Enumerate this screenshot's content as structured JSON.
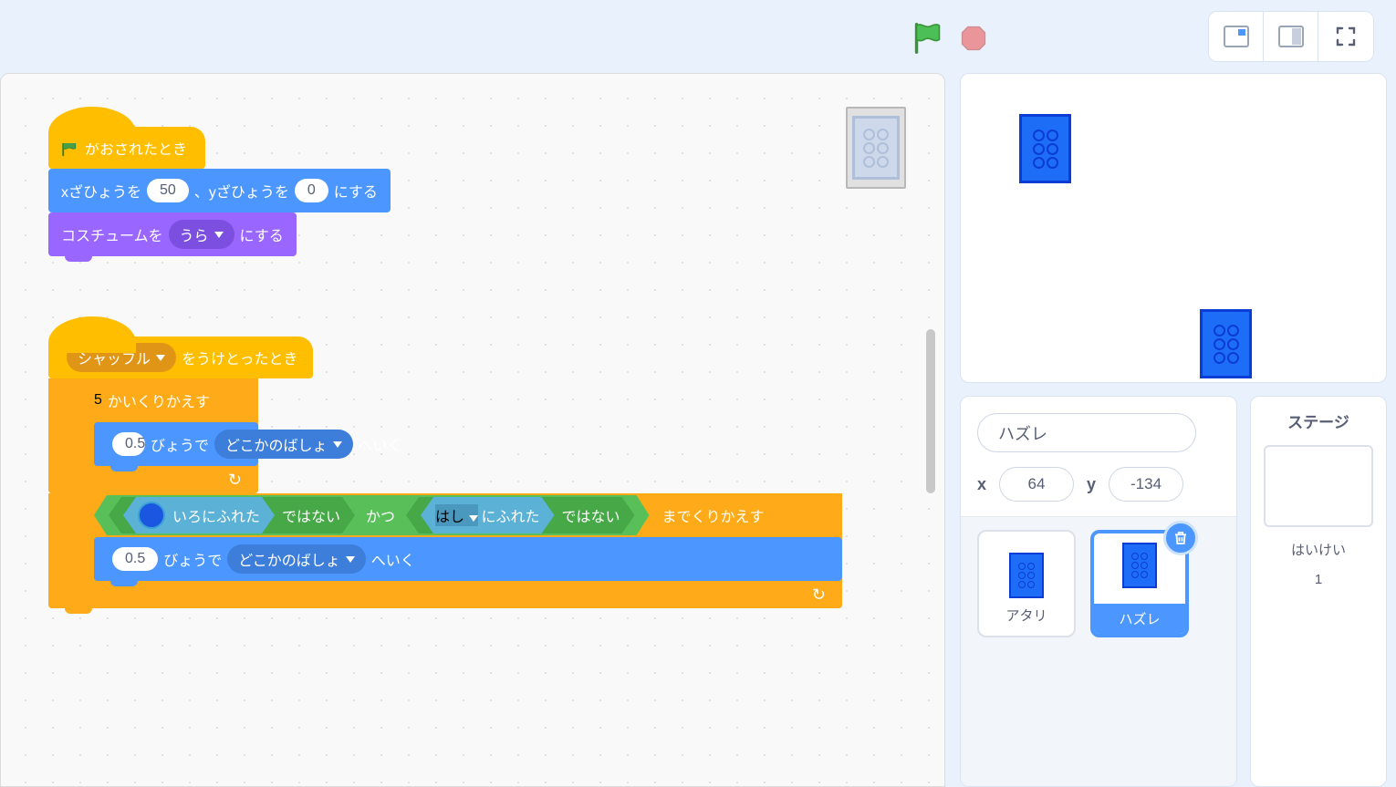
{
  "controls": {
    "flag_alt": "green-flag",
    "stop_alt": "stop"
  },
  "blocks": {
    "hat_flag": "がおされたとき",
    "goto_prefix_x": "xざひょうを",
    "goto_mid_y": "、yざひょうを",
    "goto_suffix": "にする",
    "goto_x_val": "50",
    "goto_y_val": "0",
    "switch_costume_pre": "コスチュームを",
    "switch_costume_opt": "うら",
    "switch_costume_suf": "にする",
    "hat_receive_opt": "シャッフル",
    "hat_receive_suf": "をうけとったとき",
    "repeat_val": "5",
    "repeat_suf": "かいくりかえす",
    "glide_val": "0.5",
    "glide_mid": "びょうで",
    "glide_opt": "どこかのばしょ",
    "glide_suf": "へいく",
    "repeat_until_suf": "までくりかえす",
    "not_suf": "ではない",
    "and_label": "かつ",
    "touch_color_suf": "いろにふれた",
    "touch_edge_opt": "はし",
    "touch_edge_suf": "にふれた"
  },
  "sprite_info": {
    "name": "ハズレ",
    "x_label": "x",
    "y_label": "y",
    "x_val": "64",
    "y_val": "-134"
  },
  "sprites": [
    {
      "name": "アタリ",
      "selected": false
    },
    {
      "name": "ハズレ",
      "selected": true
    }
  ],
  "stage": {
    "header": "ステージ",
    "backdrop_label": "はいけい",
    "backdrop_count": "1"
  }
}
